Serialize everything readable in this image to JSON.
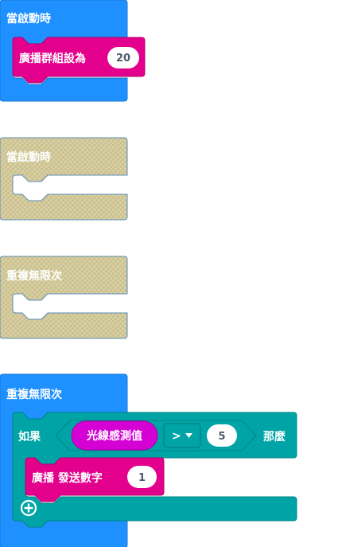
{
  "colors": {
    "basic_blue": "#1e90ff",
    "basic_blue_stroke": "#1a77d6",
    "radio_pink": "#e3008c",
    "radio_pink_stroke": "#b0006c",
    "logic_teal": "#00a4a6",
    "logic_teal_stroke": "#008385",
    "sensor_magenta": "#d400d4",
    "disabled_fill": "#cfc69a",
    "disabled_stroke": "#5b8db8"
  },
  "block1": {
    "hat_label": "當啟動時",
    "stmt_label": "廣播群組設為",
    "value": "20"
  },
  "block2": {
    "hat_label": "當啟動時"
  },
  "block3": {
    "hat_label": "重複無限次"
  },
  "block4": {
    "hat_label": "重複無限次",
    "if_label": "如果",
    "sensor_label": "光線感測值",
    "operator": ">",
    "compare_value": "5",
    "then_label": "那麼",
    "send_label": "廣播 發送數字",
    "send_value": "1",
    "add_icon": "plus-circle-icon"
  }
}
